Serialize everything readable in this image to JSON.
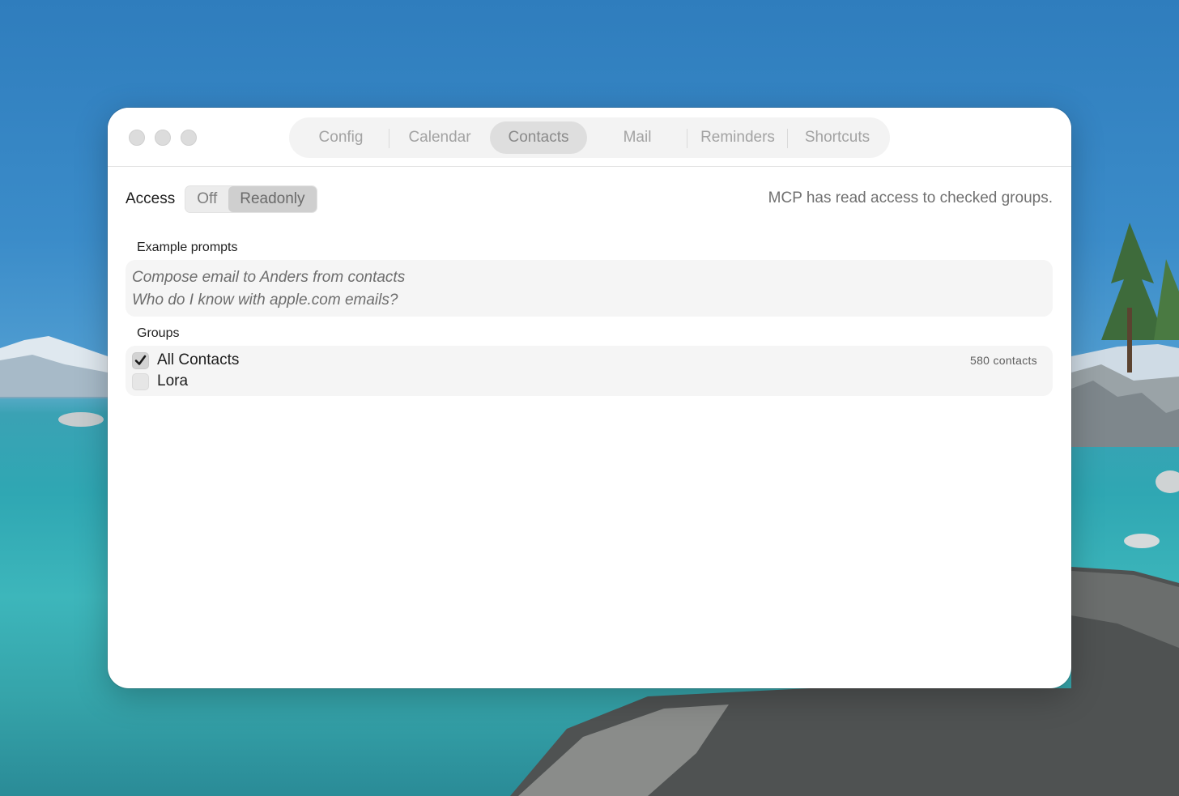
{
  "tabs": [
    {
      "label": "Config",
      "active": false
    },
    {
      "label": "Calendar",
      "active": false
    },
    {
      "label": "Contacts",
      "active": true
    },
    {
      "label": "Mail",
      "active": false
    },
    {
      "label": "Reminders",
      "active": false
    },
    {
      "label": "Shortcuts",
      "active": false
    }
  ],
  "access": {
    "label": "Access",
    "options": [
      "Off",
      "Readonly"
    ],
    "selected": "Readonly",
    "note": "MCP has read access to checked groups."
  },
  "prompts": {
    "label": "Example prompts",
    "items": [
      "Compose email to Anders from contacts",
      "Who do I know with apple.com emails?"
    ]
  },
  "groups": {
    "label": "Groups",
    "items": [
      {
        "name": "All Contacts",
        "checked": true,
        "count": "580 contacts"
      },
      {
        "name": "Lora",
        "checked": false,
        "count": ""
      }
    ]
  },
  "colors": {
    "window_bg": "#ffffff",
    "tab_active_bg": "#dedede",
    "panel_bg": "#f5f5f5"
  },
  "icons": [
    "close-button",
    "minimize-button",
    "zoom-button",
    "checkmark-icon"
  ]
}
